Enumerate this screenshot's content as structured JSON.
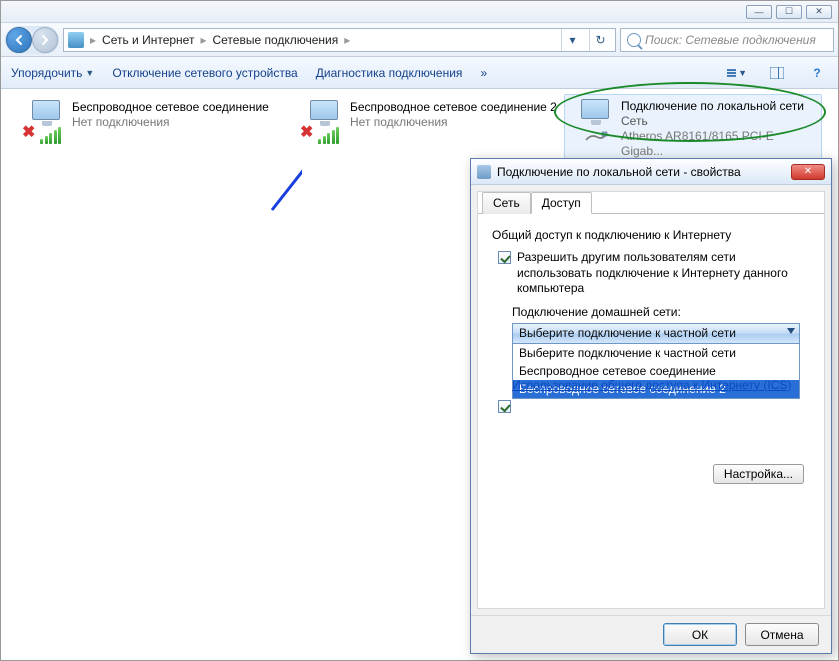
{
  "window": {
    "minimize": "—",
    "maximize": "☐",
    "close": "✕"
  },
  "address": {
    "seg1": "Сеть и Интернет",
    "seg2": "Сетевые подключения"
  },
  "search": {
    "placeholder": "Поиск: Сетевые подключения"
  },
  "toolbar": {
    "organize": "Упорядочить",
    "disable": "Отключение сетевого устройства",
    "diagnose": "Диагностика подключения",
    "more": "»"
  },
  "connections": [
    {
      "name": "Беспроводное сетевое соединение",
      "status": "Нет подключения"
    },
    {
      "name": "Беспроводное сетевое соединение 2",
      "status": "Нет подключения"
    },
    {
      "name": "Подключение по локальной сети",
      "status": "Сеть",
      "device": "Atheros AR8161/8165 PCI-E Gigab..."
    }
  ],
  "dialog": {
    "title": "Подключение по локальной сети - свойства",
    "tabs": {
      "net": "Сеть",
      "access": "Доступ"
    },
    "group": "Общий доступ к подключению к Интернету",
    "chk1": "Разрешить другим пользователям сети использовать подключение к Интернету данного компьютера",
    "sublabel": "Подключение домашней сети:",
    "combo_selected": "Выберите подключение к частной сети",
    "options": [
      "Выберите подключение к частной сети",
      "Беспроводное сетевое соединение",
      "Беспроводное сетевое соединение 2"
    ],
    "link": "Использование общего доступа к Интернету (ICS)",
    "configure": "Настройка...",
    "ok": "ОК",
    "cancel": "Отмена"
  }
}
